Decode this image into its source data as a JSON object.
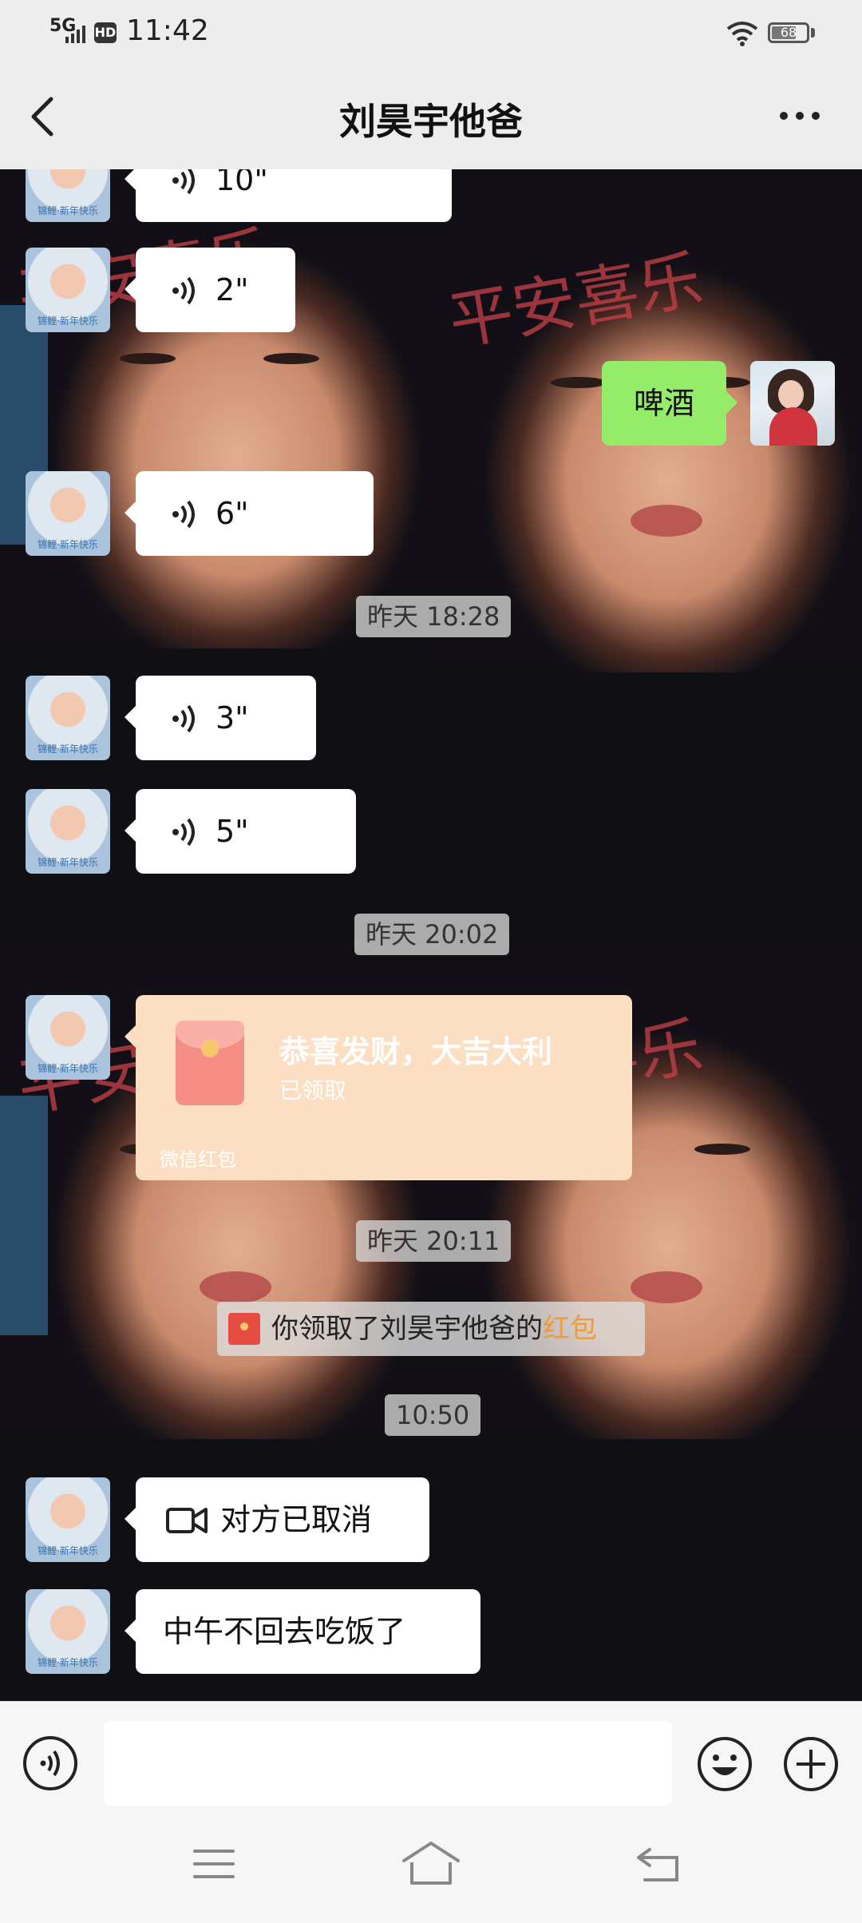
{
  "status_bar": {
    "network": "5G",
    "hd": "HD",
    "time": "11:42",
    "battery": "68"
  },
  "header": {
    "title": "刘昊宇他爸",
    "back_icon": "chevron-left-icon",
    "more_icon": "more-dots-icon"
  },
  "messages": {
    "voice_1": "10\"",
    "voice_2": "2\"",
    "me_text": "啤酒",
    "voice_3": "6\"",
    "ts_1": "昨天 18:28",
    "voice_4": "3\"",
    "voice_5": "5\"",
    "ts_2": "昨天 20:02",
    "red_packet": {
      "title": "恭喜发财，大吉大利",
      "status": "已领取",
      "footer": "微信红包"
    },
    "ts_3": "昨天 20:11",
    "system": {
      "prefix": "你领取了刘昊宇他爸的",
      "link": "红包"
    },
    "ts_4": "10:50",
    "video_call": "对方已取消",
    "last_text": "中午不回去吃饭了"
  },
  "input_bar": {
    "voice_icon": "voice-input-icon",
    "emoji_icon": "emoji-icon",
    "plus_icon": "plus-icon"
  },
  "nav": {
    "menu_icon": "menu-icon",
    "home_icon": "home-icon",
    "back_icon": "back-icon"
  },
  "colors": {
    "my_bubble": "#95ec69",
    "red_packet": "#fcdfc2",
    "link": "#f19a38"
  }
}
